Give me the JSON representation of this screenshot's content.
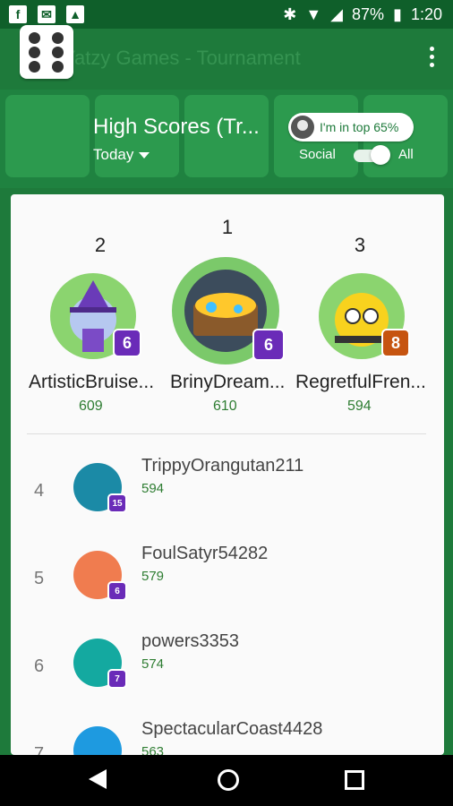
{
  "status_bar": {
    "battery": "87%",
    "time": "1:20",
    "left_icons": [
      "facebook-icon",
      "mail-icon",
      "image-icon"
    ],
    "right_icons": [
      "bluetooth-icon",
      "wifi-icon",
      "signal-icon",
      "battery-icon"
    ]
  },
  "app_bar": {
    "faded_title": "Yatzy Games - Tournament"
  },
  "header": {
    "title": "High Scores (Tr...",
    "time_filter": "Today",
    "top_percent_text": "I'm in top 65%",
    "toggle_left_label": "Social",
    "toggle_right_label": "All",
    "toggle_state": "All"
  },
  "podium": [
    {
      "rank": "2",
      "name": "ArtisticBruise...",
      "score": "609",
      "level": "6",
      "badge_color": "#6a2bb8"
    },
    {
      "rank": "1",
      "name": "BrinyDream...",
      "score": "610",
      "level": "6",
      "badge_color": "#6a2bb8"
    },
    {
      "rank": "3",
      "name": "RegretfulFren...",
      "score": "594",
      "level": "8",
      "badge_color": "#c65410"
    }
  ],
  "list": [
    {
      "rank": "4",
      "name": "TrippyOrangutan211",
      "score": "594",
      "level": "15"
    },
    {
      "rank": "5",
      "name": "FoulSatyr54282",
      "score": "579",
      "level": "6"
    },
    {
      "rank": "6",
      "name": "powers3353",
      "score": "574",
      "level": "7"
    },
    {
      "rank": "7",
      "name": "SpectacularCoast4428",
      "score": "563",
      "level": ""
    }
  ],
  "colors": {
    "primary": "#1e7a3b",
    "card_bg": "#fafafa",
    "score_green": "#2e7d32"
  }
}
